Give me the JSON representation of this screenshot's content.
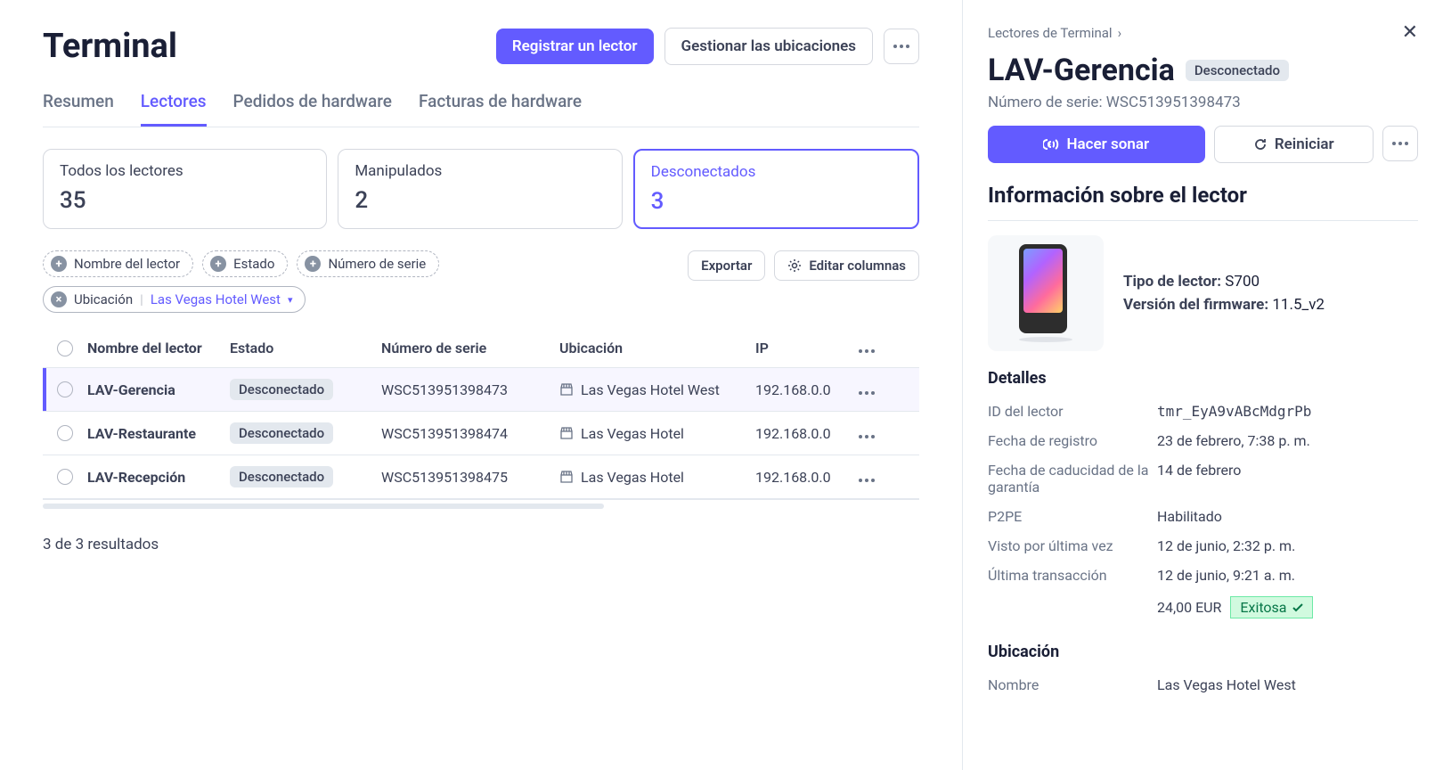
{
  "header": {
    "title": "Terminal",
    "register": "Registrar un lector",
    "manage_locations": "Gestionar las ubicaciones"
  },
  "tabs": [
    {
      "label": "Resumen"
    },
    {
      "label": "Lectores"
    },
    {
      "label": "Pedidos de hardware"
    },
    {
      "label": "Facturas de hardware"
    }
  ],
  "stats": [
    {
      "label": "Todos los lectores",
      "value": "35"
    },
    {
      "label": "Manipulados",
      "value": "2"
    },
    {
      "label": "Desconectados",
      "value": "3"
    }
  ],
  "filters": {
    "reader_name": "Nombre del lector",
    "status": "Estado",
    "serial": "Número de serie",
    "location_label": "Ubicación",
    "location_value": "Las Vegas Hotel West",
    "export": "Exportar",
    "edit_columns": "Editar columnas"
  },
  "table": {
    "headers": {
      "name": "Nombre del lector",
      "status": "Estado",
      "serial": "Número de serie",
      "location": "Ubicación",
      "ip": "IP"
    },
    "rows": [
      {
        "name": "LAV-Gerencia",
        "status": "Desconectado",
        "serial": "WSC513951398473",
        "location": "Las Vegas Hotel West",
        "ip": "192.168.0.0",
        "selected": true
      },
      {
        "name": "LAV-Restaurante",
        "status": "Desconectado",
        "serial": "WSC513951398474",
        "location": "Las Vegas Hotel",
        "ip": "192.168.0.0",
        "selected": false
      },
      {
        "name": "LAV-Recepción",
        "status": "Desconectado",
        "serial": "WSC513951398475",
        "location": "Las Vegas Hotel",
        "ip": "192.168.0.0",
        "selected": false
      }
    ],
    "results": "3 de 3 resultados"
  },
  "side": {
    "crumb": "Lectores de Terminal",
    "title": "LAV-Gerencia",
    "status": "Desconectado",
    "serial_label": "Número de serie:",
    "serial": "WSC513951398473",
    "ring": "Hacer sonar",
    "restart": "Reiniciar",
    "info_heading": "Información sobre el lector",
    "type_label": "Tipo de lector:",
    "type_value": "S700",
    "fw_label": "Versión del firmware:",
    "fw_value": "11.5_v2",
    "details_heading": "Detalles",
    "details": {
      "id_label": "ID del lector",
      "id_value": "tmr_EyA9vABcMdgrPb",
      "reg_label": "Fecha de registro",
      "reg_value": "23 de febrero, 7:38 p. m.",
      "warranty_label": "Fecha de caducidad de la garantía",
      "warranty_value": "14 de febrero",
      "p2pe_label": "P2PE",
      "p2pe_value": "Habilitado",
      "last_seen_label": "Visto por última vez",
      "last_seen_value": "12 de junio, 2:32 p. m.",
      "last_tx_label": "Última transacción",
      "last_tx_value": "12 de junio, 9:21 a. m.",
      "amount": "24,00 EUR",
      "tx_status": "Exitosa"
    },
    "location_heading": "Ubicación",
    "loc_name_label": "Nombre",
    "loc_name_value": "Las Vegas Hotel West"
  }
}
